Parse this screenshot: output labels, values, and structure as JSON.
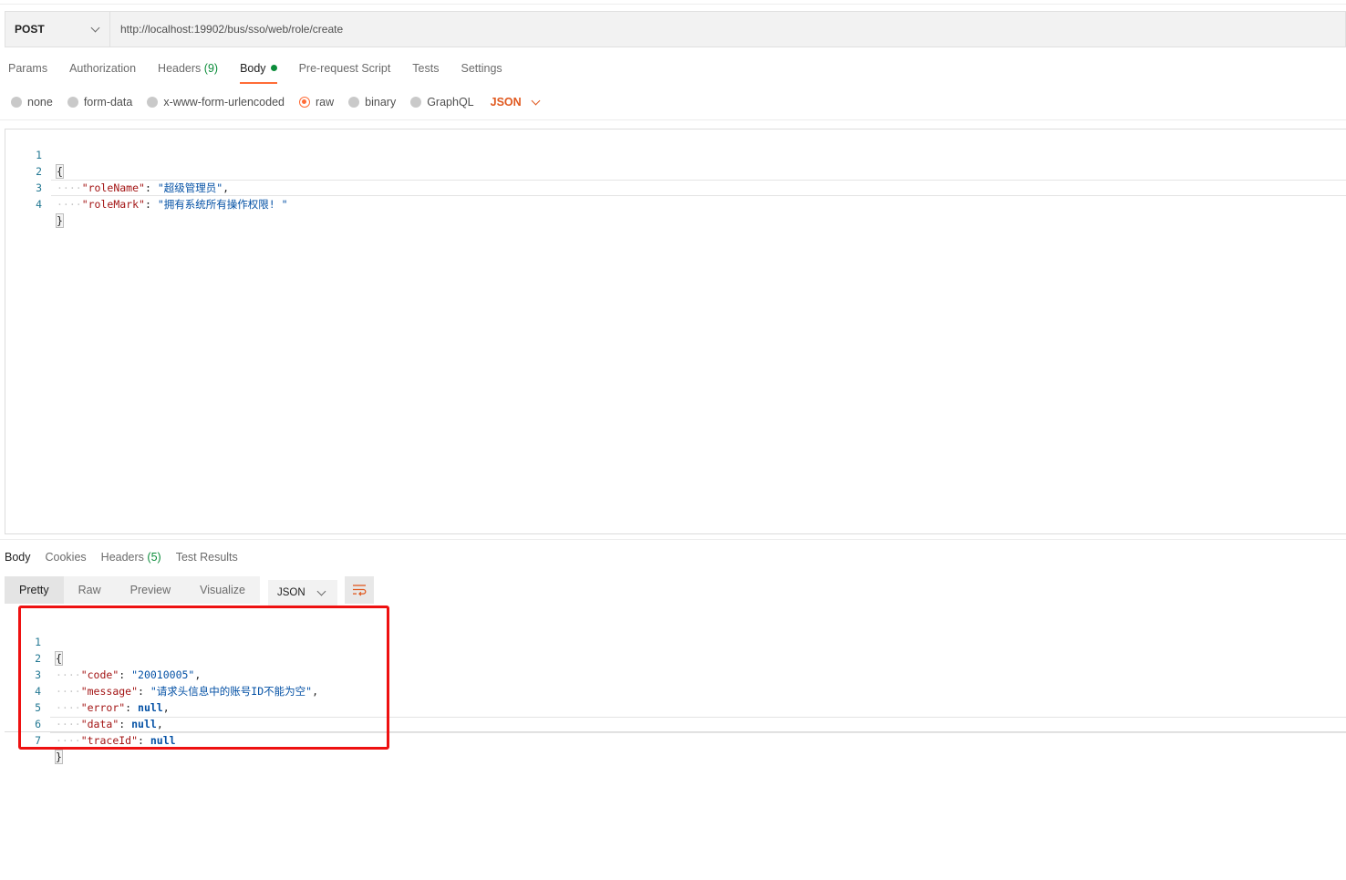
{
  "request": {
    "method": "POST",
    "url": "http://localhost:19902/bus/sso/web/role/create"
  },
  "request_tabs": [
    {
      "label": "Params"
    },
    {
      "label": "Authorization"
    },
    {
      "label": "Headers",
      "count": "(9)"
    },
    {
      "label": "Body",
      "active": true,
      "indicator": "green-dot"
    },
    {
      "label": "Pre-request Script"
    },
    {
      "label": "Tests"
    },
    {
      "label": "Settings"
    }
  ],
  "body_types": {
    "options": [
      "none",
      "form-data",
      "x-www-form-urlencoded",
      "raw",
      "binary",
      "GraphQL"
    ],
    "selected": "raw",
    "language": "JSON"
  },
  "request_body": {
    "line_numbers": [
      "1",
      "2",
      "3",
      "4"
    ],
    "open_brace": "{",
    "close_brace": "}",
    "role_name_key": "\"roleName\"",
    "role_name_value": "\"超级管理员\"",
    "role_mark_key": "\"roleMark\"",
    "role_mark_value": "\"拥有系统所有操作权限! \""
  },
  "response_tabs": [
    {
      "label": "Body",
      "active": true
    },
    {
      "label": "Cookies"
    },
    {
      "label": "Headers",
      "count": "(5)"
    },
    {
      "label": "Test Results"
    }
  ],
  "view_tabs": {
    "items": [
      "Pretty",
      "Raw",
      "Preview",
      "Visualize"
    ],
    "selected": "Pretty",
    "language": "JSON"
  },
  "response_body": {
    "line_numbers": [
      "1",
      "2",
      "3",
      "4",
      "5",
      "6",
      "7"
    ],
    "open_brace": "{",
    "close_brace": "}",
    "code_key": "\"code\"",
    "code_value": "\"20010005\"",
    "message_key": "\"message\"",
    "message_value": "\"请求头信息中的账号ID不能为空\"",
    "error_key": "\"error\"",
    "data_key": "\"data\"",
    "trace_key": "\"traceId\"",
    "null_literal": "null"
  },
  "colors": {
    "accent": "#ff6c37",
    "green": "#0c8d3b",
    "highlight": "#ee1111",
    "json_key": "#a31515",
    "json_string": "#0451a5"
  }
}
